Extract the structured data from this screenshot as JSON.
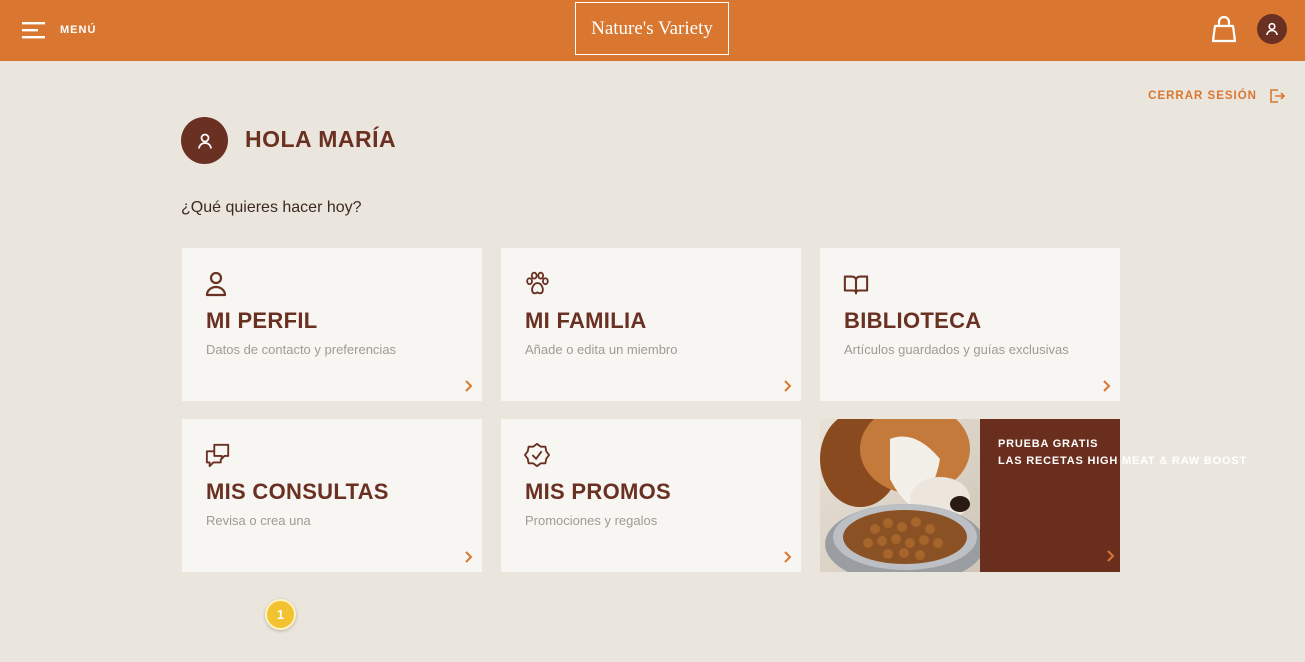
{
  "header": {
    "menu_label": "MENÚ",
    "logo_text": "Nature's Variety"
  },
  "colors": {
    "brand_orange": "#d97731",
    "brand_brown": "#6a3022",
    "background": "#ebe6dd",
    "card": "#f7f6f2"
  },
  "logout": {
    "label": "CERRAR SESIÓN",
    "icon": "logout-icon"
  },
  "greeting": {
    "title": "HOLA MARÍA",
    "question": "¿Qué quieres hacer hoy?"
  },
  "cards": [
    {
      "icon": "user-icon",
      "title": "MI PERFIL",
      "subtitle": "Datos de contacto y preferencias"
    },
    {
      "icon": "paw-icon",
      "title": "MI FAMILIA",
      "subtitle": "Añade o edita un miembro"
    },
    {
      "icon": "book-icon",
      "title": "BIBLIOTECA",
      "subtitle": "Artículos guardados y guías exclusivas"
    },
    {
      "icon": "chat-icon",
      "title": "MIS CONSULTAS",
      "subtitle": "Revisa o crea una"
    },
    {
      "icon": "badge-check-icon",
      "title": "MIS PROMOS",
      "subtitle": "Promociones y regalos"
    }
  ],
  "promo": {
    "line1": "PRUEBA GRATIS",
    "line2": "LAS RECETAS HIGH MEAT & RAW BOOST",
    "image": "dog-eating-kibble-photo"
  },
  "notification_badge": "1"
}
